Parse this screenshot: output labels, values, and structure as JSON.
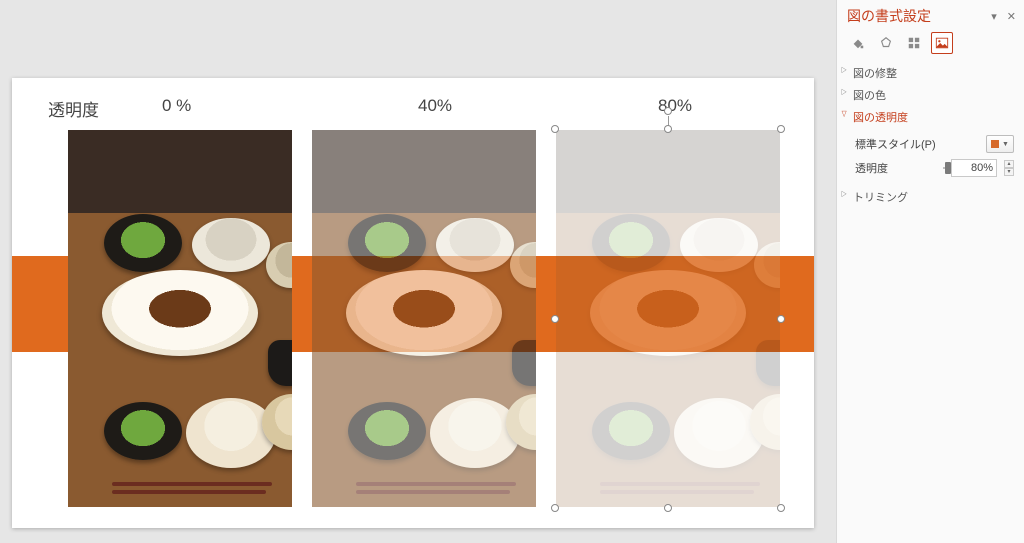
{
  "canvas": {
    "row_title": "透明度",
    "labels": {
      "v0": "0 %",
      "v40": "40%",
      "v80": "80%"
    }
  },
  "pane": {
    "title": "図の書式設定",
    "dropdown_glyph": "▾",
    "close_glyph": "✕",
    "tabs": {
      "fill": "fill-line-icon",
      "effects": "effects-icon",
      "size": "size-properties-icon",
      "picture": "picture-icon"
    },
    "sections": {
      "correction": "図の修整",
      "color": "図の色",
      "transparency": "図の透明度",
      "crop": "トリミング"
    },
    "transparency": {
      "preset_label": "標準スタイル(P)",
      "slider_label": "透明度",
      "value": "80%",
      "percent": 80
    }
  }
}
